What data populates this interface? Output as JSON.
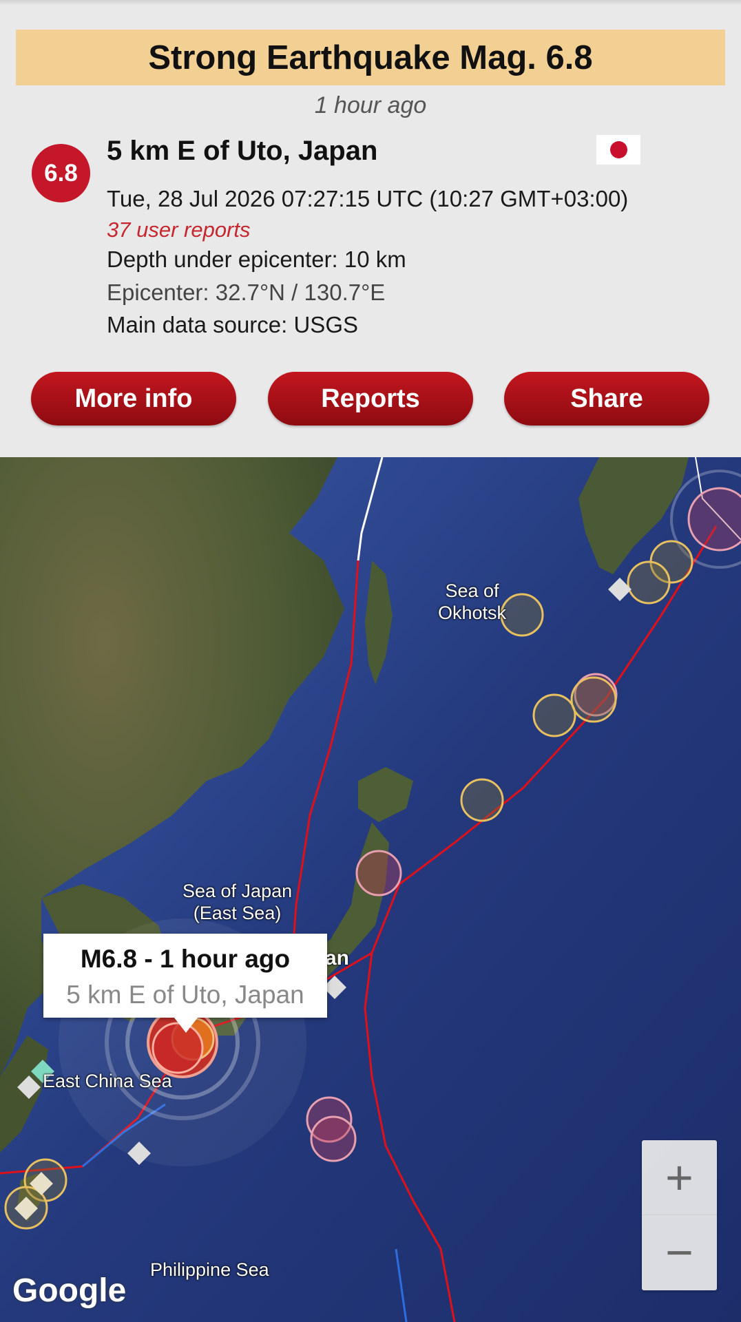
{
  "header": {
    "title": "Strong Earthquake Mag. 6.8",
    "time_ago": "1 hour ago"
  },
  "quake": {
    "magnitude": "6.8",
    "place": "5 km E of Uto, Japan",
    "datetime": "Tue, 28 Jul 2026 07:27:15 UTC (10:27 GMT+03:00)",
    "user_reports": "37 user reports",
    "depth": "Depth under epicenter: 10 km",
    "epicenter": "Epicenter: 32.7°N / 130.7°E",
    "source": "Main data source: USGS",
    "flag_icon": "japan-flag-icon",
    "badge_color": "#c4182a"
  },
  "actions": {
    "more_info": "More info",
    "reports": "Reports",
    "share": "Share"
  },
  "map": {
    "labels": {
      "okhotsk": "Sea of\nOkhotsk",
      "japan_sea": "Sea of Japan\n(East Sea)",
      "japan_partial": "an",
      "east_china_sea": "East China Sea",
      "philippine_sea": "Philippine Sea"
    },
    "popup": {
      "title": "M6.8  -  1 hour ago",
      "subtitle": "5 km E of Uto, Japan"
    },
    "zoom_in": "+",
    "zoom_out": "−",
    "attribution": "Google",
    "plate_boundary_color": "#e0101a"
  }
}
